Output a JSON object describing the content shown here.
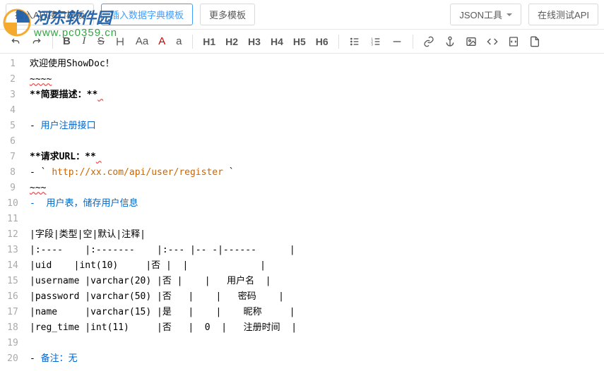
{
  "topButtons": {
    "insertApi": "插入API接口模板",
    "insertDict": "插入数据字典模板",
    "moreTpl": "更多模板",
    "jsonTool": "JSON工具",
    "testApi": "在线测试API"
  },
  "toolbar": {
    "undo": "↶",
    "redo": "↷",
    "bold": "B",
    "italic": "I",
    "strike": "S",
    "fontcase": "Aa",
    "fontA": "A",
    "fonta": "a",
    "h1": "H1",
    "h2": "H2",
    "h3": "H3",
    "h4": "H4",
    "h5": "H5",
    "h6": "H6"
  },
  "watermark": {
    "title": "河东软件园",
    "url": "www.pc0359.cn"
  },
  "editor": {
    "lines": [
      {
        "n": 1,
        "segs": [
          {
            "t": "欢迎使用ShowDoc！"
          }
        ]
      },
      {
        "n": 2,
        "segs": [
          {
            "t": "~~~~",
            "cls": "spell"
          }
        ]
      },
      {
        "n": 3,
        "segs": [
          {
            "t": "**简要描述：**",
            "cls": "bold"
          },
          {
            "t": " ",
            "cls": "spell"
          }
        ]
      },
      {
        "n": 4,
        "segs": []
      },
      {
        "n": 5,
        "segs": [
          {
            "t": "- "
          },
          {
            "t": "用户注册接口",
            "cls": "blue"
          }
        ]
      },
      {
        "n": 6,
        "segs": []
      },
      {
        "n": 7,
        "segs": [
          {
            "t": "**请求URL：**",
            "cls": "bold"
          },
          {
            "t": " ",
            "cls": "spell"
          }
        ]
      },
      {
        "n": 8,
        "segs": [
          {
            "t": "- ` "
          },
          {
            "t": "http://xx.com/api/user/register",
            "cls": "codeurl"
          },
          {
            "t": " `"
          }
        ]
      },
      {
        "n": 9,
        "segs": [
          {
            "t": "~~~",
            "cls": "spell"
          }
        ]
      },
      {
        "n": 10,
        "segs": [
          {
            "t": "-  ",
            "cls": "blue"
          },
          {
            "t": "用户表，储存用户信息",
            "cls": "blue"
          }
        ]
      },
      {
        "n": 11,
        "segs": []
      },
      {
        "n": 12,
        "segs": [
          {
            "t": "|字段|类型|空|默认|注释|"
          }
        ]
      },
      {
        "n": 13,
        "segs": [
          {
            "t": "|:----    |:-------    |:--- |-- -|------      |"
          }
        ]
      },
      {
        "n": 14,
        "segs": [
          {
            "t": "|uid    |int(10)     |否 |  |             |"
          }
        ]
      },
      {
        "n": 15,
        "segs": [
          {
            "t": "|username |varchar(20) |否 |    |   用户名  |"
          }
        ]
      },
      {
        "n": 16,
        "segs": [
          {
            "t": "|password |varchar(50) |否   |    |   密码    |"
          }
        ]
      },
      {
        "n": 17,
        "segs": [
          {
            "t": "|name     |varchar(15) |是   |    |    昵称     |"
          }
        ]
      },
      {
        "n": 18,
        "segs": [
          {
            "t": "|reg_time |int(11)     |否   |  0  |   注册时间  |"
          }
        ]
      },
      {
        "n": 19,
        "segs": []
      },
      {
        "n": 20,
        "segs": [
          {
            "t": "- "
          },
          {
            "t": "备注：无",
            "cls": "blue"
          }
        ]
      }
    ]
  }
}
